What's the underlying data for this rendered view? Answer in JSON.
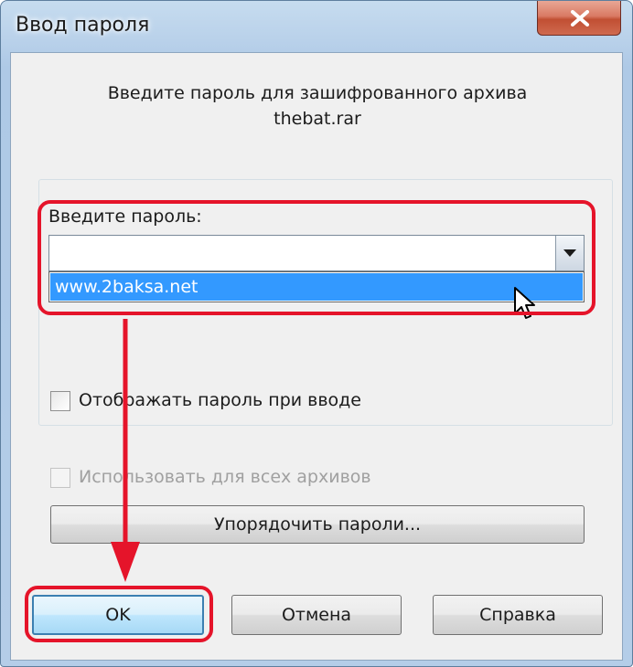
{
  "window": {
    "title": "Ввод пароля"
  },
  "prompt": {
    "line1": "Введите пароль для зашифрованного архива",
    "line2": "thebat.rar"
  },
  "password": {
    "label": "Введите пароль:",
    "value": "",
    "dropdown_items": [
      "www.2baksa.net"
    ]
  },
  "options": {
    "show_password_label": "Отображать пароль при вводе",
    "show_password_checked": false,
    "use_for_all_label": "Использовать для всех архивов",
    "use_for_all_checked": false,
    "use_for_all_enabled": false
  },
  "buttons": {
    "organize": "Упорядочить пароли...",
    "ok": "OK",
    "cancel": "Отмена",
    "help": "Справка"
  },
  "annotation": {
    "color": "#e5142a"
  },
  "icons": {
    "close": "close-icon",
    "dropdown": "chevron-down-icon",
    "cursor": "mouse-pointer-icon"
  }
}
